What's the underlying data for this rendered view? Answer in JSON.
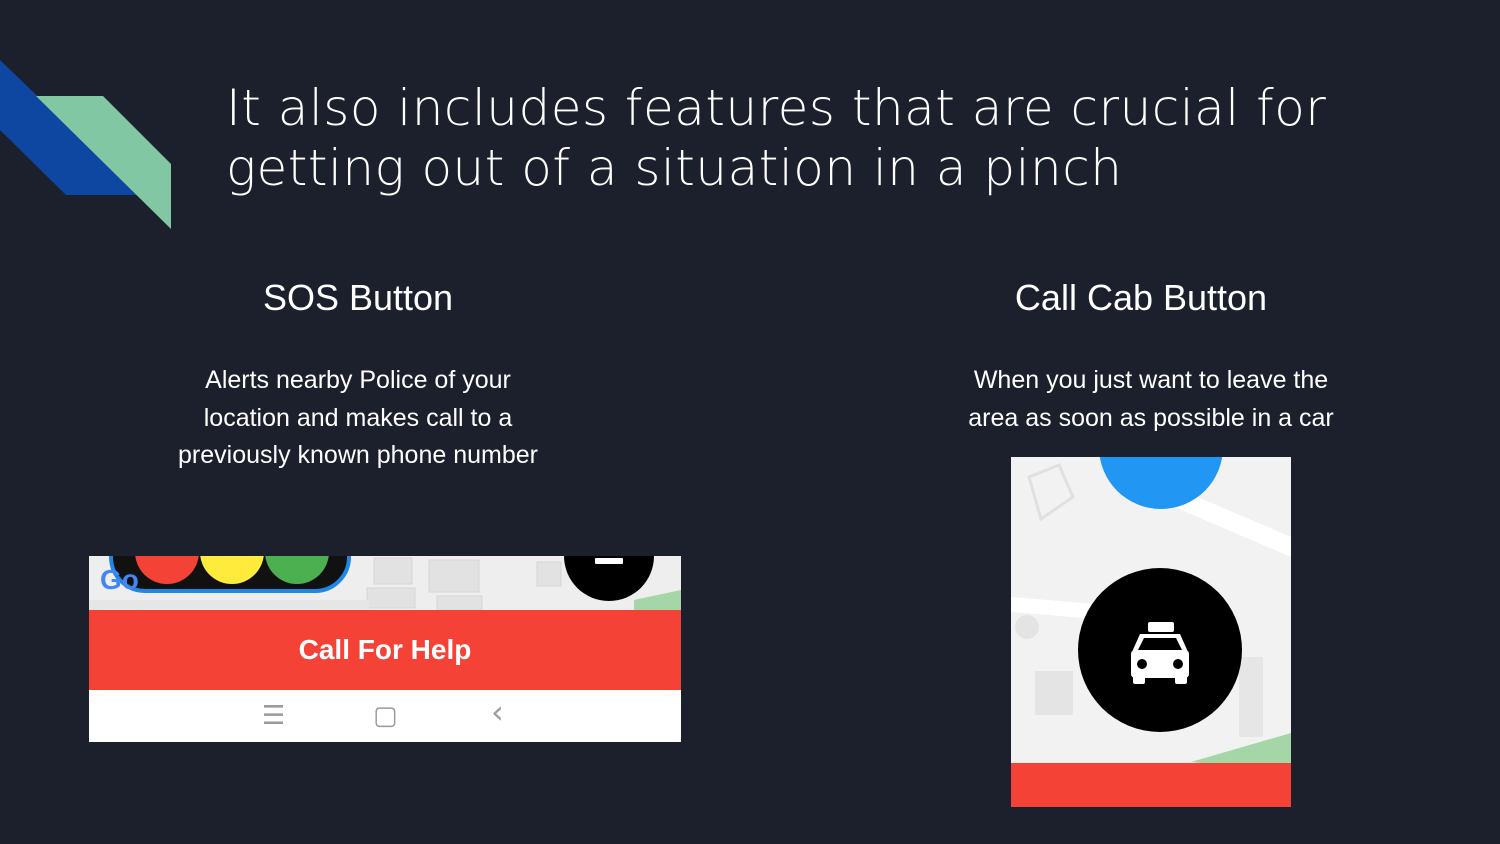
{
  "slide": {
    "title_lines": [
      "It also includes features that are crucial for",
      "getting out of a situation in a pinch"
    ],
    "decoration_colors": {
      "blue": "#0d47a1",
      "teal": "#81c7a4"
    }
  },
  "sos": {
    "heading": "SOS Button",
    "description_lines": [
      "Alerts nearby Police of your",
      "location and makes call to a",
      "previously known phone number"
    ],
    "screenshot": {
      "map_logo_fragment": "Go",
      "call_button_label": "Call For Help",
      "nav_icons": [
        "menu-icon",
        "home-icon",
        "back-icon"
      ],
      "nav_glyphs": {
        "menu": "☰",
        "home": "▢",
        "back": "‹"
      },
      "button_color": "#f44336",
      "light_colors": [
        "#f44336",
        "#ffeb3b",
        "#4caf50"
      ]
    }
  },
  "cab": {
    "heading": "Call Cab Button",
    "description_lines": [
      "When you just want to leave the",
      "area as soon as possible in a car"
    ],
    "screenshot": {
      "cab_icon": "taxi-icon",
      "location_dot_color": "#2196f3",
      "bottom_bar_color": "#f44336"
    }
  }
}
